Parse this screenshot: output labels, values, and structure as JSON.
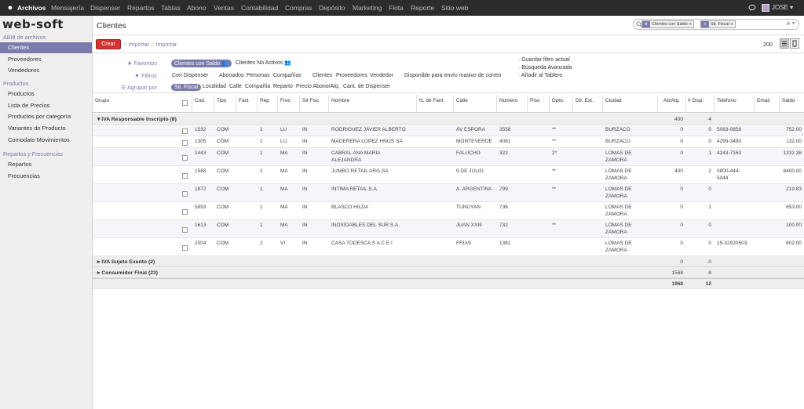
{
  "topbar": {
    "menu": [
      "Archivos",
      "Mensajería",
      "Dispenser",
      "Repartos",
      "Tablas",
      "Abono",
      "Ventas",
      "Contabilidad",
      "Compras",
      "Depósito",
      "Marketing",
      "Flota",
      "Reporte",
      "Sitio web"
    ],
    "active_menu": "Archivos",
    "user": "JOSE"
  },
  "sidebar": {
    "brand": "web-soft",
    "sections": [
      {
        "title": "ABM de archivos",
        "items": [
          "Clientes",
          "Proveedores",
          "Vendedores"
        ]
      },
      {
        "title": "Productos",
        "items": [
          "Productos",
          "Lista de Precios",
          "Productos por categoría",
          "Variantes de Producto",
          "Comodato Movimientos"
        ]
      },
      {
        "title": "Repartos y Frecuencias",
        "items": [
          "Repartos",
          "Frecuencias"
        ]
      }
    ],
    "active_item": "Clientes"
  },
  "page": {
    "title": "Clientes",
    "create_label": "Crear",
    "import1": "Importar",
    "import2": "Importar",
    "pager": "200"
  },
  "search": {
    "facets": [
      {
        "icon": "star-icon",
        "label": "Clientes con Saldo"
      },
      {
        "icon": "group-icon",
        "label": "Sit. Fiscal"
      }
    ]
  },
  "search_panel": {
    "favoritos_label": "Favoritos",
    "filtros_label": "Filtros",
    "agrupar_label": "Agrupar por",
    "favoritos": [
      "Clientes con Saldo",
      "Clientes No Activos"
    ],
    "filtros": [
      "Con Dispenser",
      "Abonados",
      "Personas",
      "Compañías",
      "Clientes",
      "Proveedores",
      "Vendedor",
      "Disponible para envío masivo de correo"
    ],
    "agrupar": [
      "Sit. Fiscal",
      "Localidad",
      "Calle",
      "Compañía",
      "Reparto",
      "Precio Abono/Alq.",
      "Cant. de Dispenser"
    ],
    "right": [
      "Guardar filtro actual",
      "Búsqueda Avanzada",
      "Añadir al Tablero"
    ]
  },
  "table": {
    "headers": [
      "Grupo",
      "Cod.",
      "Tipo",
      "Fact",
      "Rep",
      "Frec",
      "Sit Fisc",
      "Nombre",
      "N. de Fant.",
      "Calle",
      "Numero",
      "Piso",
      "Dpto.",
      "Dir. Ext.",
      "Ciudad",
      "Ab/Alq.",
      "# Disp.",
      "Teléfono",
      "Email",
      "Saldo"
    ],
    "groups": [
      {
        "label": "IVA Responsable Inscripto (8)",
        "abalq": "400",
        "disp": "4",
        "expanded": true
      },
      {
        "label": "IVA Sujeto Exento (2)",
        "abalq": "0",
        "disp": "0",
        "expanded": false
      },
      {
        "label": "Consumidor Final (23)",
        "abalq": "1568",
        "disp": "8",
        "expanded": false
      }
    ],
    "rows": [
      {
        "cod": "1532",
        "tipo": "COM",
        "fact": "1",
        "frec": "LU",
        "sit": "IN",
        "nombre": [
          "RODRIGUEZ JAVIER ALBERTO"
        ],
        "calle": "AV ESPORA",
        "numero": "3558",
        "dpto": "**",
        "ciudad": [
          "BURZACO"
        ],
        "abalq": "0",
        "disp": "0",
        "tel": [
          "5083-0858"
        ],
        "saldo": "752.00"
      },
      {
        "cod": "1305",
        "tipo": "COM",
        "fact": "1",
        "frec": "LU",
        "sit": "IN",
        "nombre": [
          "MADERERA LOPEZ HNOS SA"
        ],
        "calle": "MONTEVERDE",
        "numero": "4081",
        "dpto": "**",
        "ciudad": [
          "BURZACO"
        ],
        "abalq": "0",
        "disp": "0",
        "tel": [
          "4299-3490"
        ],
        "saldo": "132.00"
      },
      {
        "cod": "1443",
        "tipo": "COM",
        "fact": "1",
        "frec": "MA",
        "sit": "IN",
        "nombre": [
          "CABRAL ANA MARIA",
          "ALEJANDRA"
        ],
        "calle": "FALUCHO",
        "numero": "322",
        "dpto": "2*",
        "ciudad": [
          "LOMAS DE",
          "ZAMORA"
        ],
        "abalq": "0",
        "disp": "1",
        "tel": [
          "4243-7160"
        ],
        "saldo": "1332.38"
      },
      {
        "cod": "1588",
        "tipo": "COM",
        "fact": "1",
        "frec": "MA",
        "sit": "IN",
        "nombre": [
          "JUMBO RETAIL ARG.SA"
        ],
        "calle": "9 DE JULIO",
        "numero": "",
        "dpto": "**",
        "ciudad": [
          "LOMAS DE",
          "ZAMORA"
        ],
        "abalq": "400",
        "disp": "2",
        "tel": [
          "0800-444-",
          "5044"
        ],
        "saldo": "8400.00"
      },
      {
        "cod": "1872",
        "tipo": "COM",
        "fact": "1",
        "frec": "MA",
        "sit": "IN",
        "nombre": [
          "INTIMA RETAIL S.A."
        ],
        "calle": "A. ARGENTINA",
        "numero": "799",
        "dpto": "**",
        "ciudad": [
          "LOMAS DE",
          "ZAMORA"
        ],
        "abalq": "0",
        "disp": "0",
        "tel": [
          ""
        ],
        "saldo": "219.83"
      },
      {
        "cod": "5893",
        "tipo": "COM",
        "fact": "1",
        "frec": "MA",
        "sit": "IN",
        "nombre": [
          "BLASCO HILDA"
        ],
        "calle": "TUNUYAN",
        "numero": "736",
        "dpto": "",
        "ciudad": [
          "LOMAS DE",
          "ZAMORA"
        ],
        "abalq": "0",
        "disp": "1",
        "tel": [
          ""
        ],
        "saldo": "653.00"
      },
      {
        "cod": "1613",
        "tipo": "COM",
        "fact": "1",
        "frec": "MA",
        "sit": "IN",
        "nombre": [
          "INOXIDABLES DEL SUR S.A."
        ],
        "calle": "JUAN XXIII",
        "numero": "732",
        "dpto": "**",
        "ciudad": [
          "LOMAS DE",
          "ZAMORA"
        ],
        "abalq": "0",
        "disp": "0",
        "tel": [
          ""
        ],
        "saldo": "100.00"
      },
      {
        "cod": "2004",
        "tipo": "COM",
        "fact": "2",
        "frec": "VI",
        "sit": "IN",
        "nombre": [
          "CASA TODESCA S A C E I"
        ],
        "calle": "FRIAS",
        "numero": "1381",
        "dpto": "",
        "ciudad": [
          "LOMAS DE",
          "ZAMORA"
        ],
        "abalq": "0",
        "disp": "0",
        "tel": [
          "15-32920503"
        ],
        "saldo": "602.00"
      }
    ],
    "totals": {
      "abalq": "1968",
      "disp": "12"
    }
  },
  "colors": {
    "accent": "#7c7bad",
    "create": "#d43333",
    "topbar": "#2c2c2c"
  }
}
